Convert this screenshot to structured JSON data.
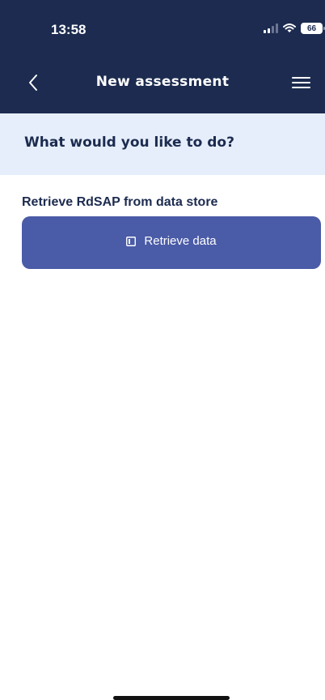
{
  "status_bar": {
    "time": "13:58",
    "battery": "66"
  },
  "nav": {
    "title": "New assessment"
  },
  "question": {
    "text": "What would you like to do?"
  },
  "section": {
    "label": "Retrieve RdSAP from data store",
    "button_label": "Retrieve data"
  },
  "icons": {
    "back": "chevron-left-icon",
    "menu": "hamburger-menu-icon",
    "button": "document-icon",
    "signal": "cellular-signal-icon",
    "wifi": "wifi-icon",
    "battery": "battery-icon"
  },
  "colors": {
    "header": "#1c2b4f",
    "banner": "#e6eefb",
    "button": "#4a5ba7",
    "text": "#1c2b4f"
  }
}
